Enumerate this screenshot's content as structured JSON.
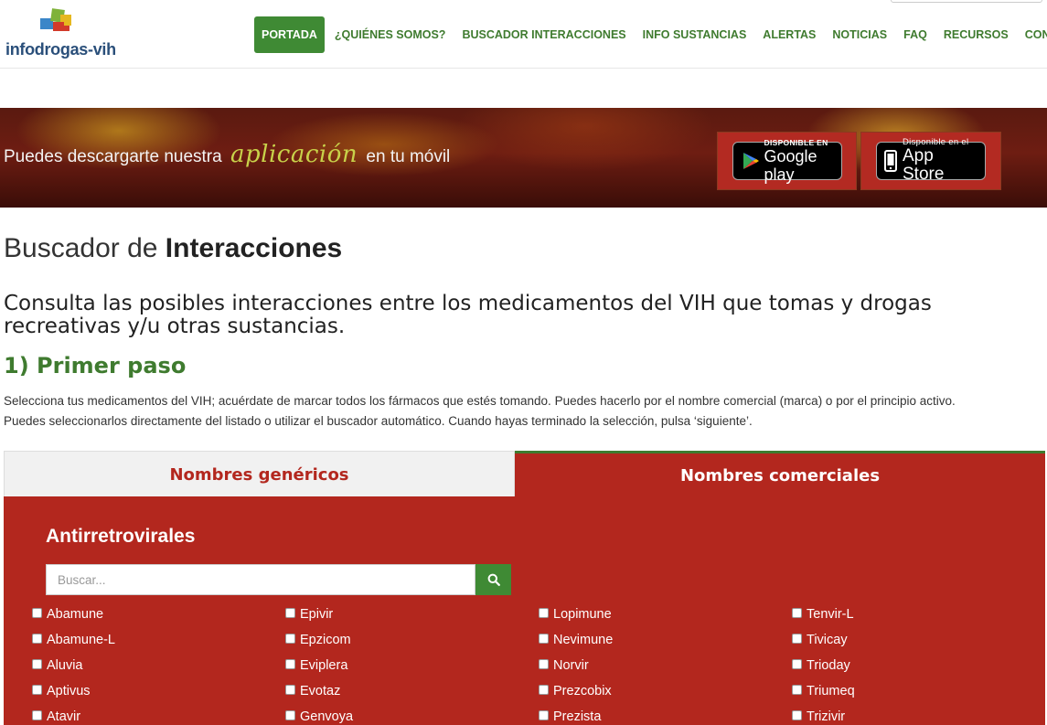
{
  "header": {
    "logo_text": "infodrogas-vih",
    "nav": [
      {
        "label": "PORTADA",
        "active": true
      },
      {
        "label": "¿QUIÉNES SOMOS?"
      },
      {
        "label": "BUSCADOR INTERACCIONES"
      },
      {
        "label": "INFO SUSTANCIAS"
      },
      {
        "label": "ALERTAS"
      },
      {
        "label": "NOTICIAS"
      },
      {
        "label": "FAQ"
      },
      {
        "label": "RECURSOS"
      },
      {
        "label": "CONSULTAS"
      }
    ]
  },
  "banner": {
    "text_before": "Puedes descargarte nuestra",
    "text_highlight": "aplicación",
    "text_after": "en tu móvil",
    "google_small": "DISPONIBLE EN",
    "google_big": "Google play",
    "apple_small": "Disponible en el",
    "apple_big": "App Store"
  },
  "main": {
    "title_light": "Buscador de",
    "title_bold": "Interacciones",
    "intro": "Consulta las posibles interacciones entre los medicamentos del VIH que tomas y drogas recreativas y/u otras sustancias.",
    "step": "1) Primer paso",
    "desc_line1": "Selecciona tus medicamentos del VIH; acuérdate de marcar todos los fármacos que estés tomando. Puedes hacerlo por el nombre comercial (marca) o por el principio activo.",
    "desc_line2": "Puedes seleccionarlos directamente del listado o utilizar el buscador automático. Cuando hayas terminado la selección, pulsa ‘siguiente’."
  },
  "tabs": {
    "generic": "Nombres genéricos",
    "commercial": "Nombres comerciales"
  },
  "panel": {
    "title": "Antirretrovirales",
    "search_placeholder": "Buscar...",
    "columns": [
      [
        "Abamune",
        "Abamune-L",
        "Aluvia",
        "Aptivus",
        "Atavir"
      ],
      [
        "Epivir",
        "Epzicom",
        "Eviplera",
        "Evotaz",
        "Genvoya"
      ],
      [
        "Lopimune",
        "Nevimune",
        "Norvir",
        "Prezcobix",
        "Prezista"
      ],
      [
        "Tenvir-L",
        "Tivicay",
        "Trioday",
        "Triumeq",
        "Trizivir"
      ]
    ]
  }
}
